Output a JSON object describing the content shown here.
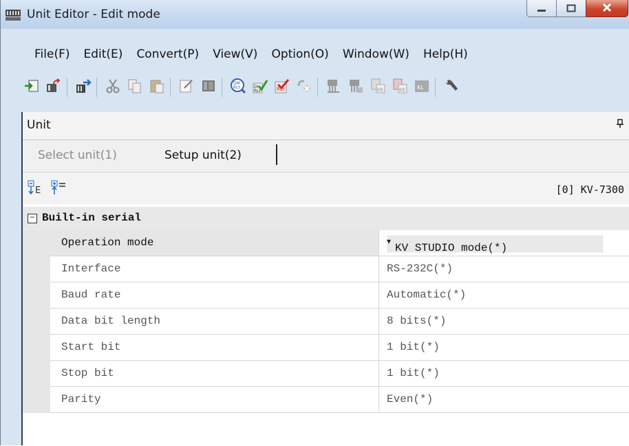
{
  "window": {
    "title": "Unit Editor - Edit mode",
    "icons": {
      "app": "unit-editor-app-icon",
      "minimize": "minimize-icon",
      "maximize": "maximize-icon",
      "close": "close-icon"
    }
  },
  "menu": [
    "File(F)",
    "Edit(E)",
    "Convert(P)",
    "View(V)",
    "Option(O)",
    "Window(W)",
    "Help(H)"
  ],
  "toolbar_icons": [
    "import-icon",
    "export-icon",
    "transfer-icon",
    "cut-icon",
    "copy-icon",
    "paste-icon",
    "edit-icon",
    "grid-icon",
    "dm-rly-icon",
    "check-rly-icon",
    "checklist-icon",
    "disabled-link-icon",
    "unit-tree-icon",
    "unit-config-icon",
    "ke-icon",
    "ke-red-icon",
    "kl-icon",
    "settings-icon"
  ],
  "panel": {
    "title": "Unit",
    "pin_icon": "pin-icon",
    "tabs": {
      "select": "Select unit(1)",
      "setup": "Setup unit(2)"
    },
    "unit_label": "[0] KV-7300",
    "group": "Built-in serial",
    "group_toggle": "−",
    "dropdown_icon": "▾",
    "rows": [
      {
        "name": "Operation mode",
        "value": "KV STUDIO mode(*)"
      },
      {
        "name": "Interface",
        "value": "RS-232C(*)"
      },
      {
        "name": "Baud rate",
        "value": "Automatic(*)"
      },
      {
        "name": "Data bit length",
        "value": "8 bits(*)"
      },
      {
        "name": "Start bit",
        "value": "1 bit(*)"
      },
      {
        "name": "Stop bit",
        "value": "1 bit(*)"
      },
      {
        "name": "Parity",
        "value": "Even(*)"
      }
    ]
  },
  "colors": {
    "titlebar": "#c6d9ef",
    "close": "#c9452d",
    "frame": "#d7e4f2",
    "panel_border": "#2f3e59"
  }
}
